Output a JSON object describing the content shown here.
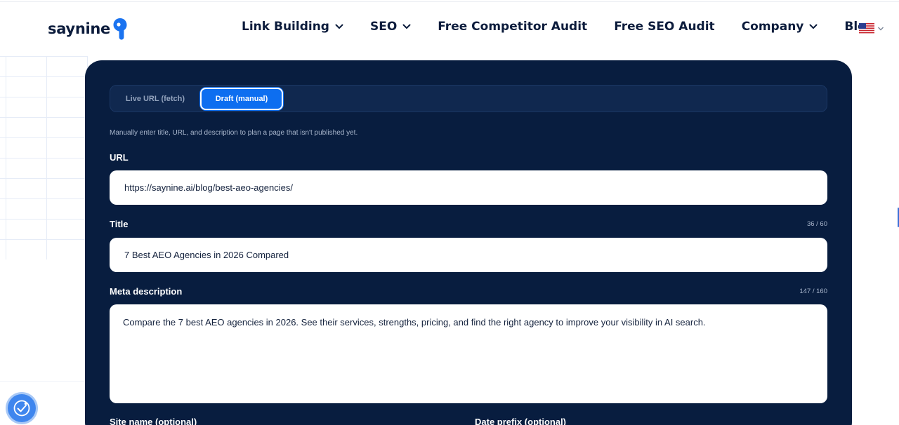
{
  "brand": {
    "name": "saynine",
    "accent": "#1a73f0"
  },
  "nav": {
    "items": [
      {
        "label": "Link Building",
        "has_dropdown": true
      },
      {
        "label": "SEO",
        "has_dropdown": true
      },
      {
        "label": "Free Competitor Audit",
        "has_dropdown": false
      },
      {
        "label": "Free SEO Audit",
        "has_dropdown": false
      },
      {
        "label": "Company",
        "has_dropdown": true
      },
      {
        "label": "Blog",
        "has_dropdown": false
      }
    ],
    "language_icon": "us-flag-icon"
  },
  "form": {
    "tabs": [
      {
        "label": "Live URL (fetch)",
        "active": false
      },
      {
        "label": "Draft (manual)",
        "active": true
      }
    ],
    "hint": "Manually enter title, URL, and description to plan a page that isn't published yet.",
    "url": {
      "label": "URL",
      "value": "https://saynine.ai/blog/best-aeo-agencies/"
    },
    "title": {
      "label": "Title",
      "value": "7 Best AEO Agencies in 2026 Compared",
      "counter": "36 / 60"
    },
    "meta": {
      "label": "Meta description",
      "value": "Compare the 7 best AEO agencies in 2026. See their services, strengths, pricing, and find the right agency to improve your visibility in AI search.",
      "counter": "147 / 160"
    },
    "site_name": {
      "label": "Site name (optional)"
    },
    "date_prefix": {
      "label": "Date prefix (optional)"
    }
  },
  "colors": {
    "panel": "#081d3f",
    "active_tab": "#0d6ef0",
    "badge": "#3f86ee"
  },
  "accessibility_badge_icon": "accessibility-check-icon"
}
